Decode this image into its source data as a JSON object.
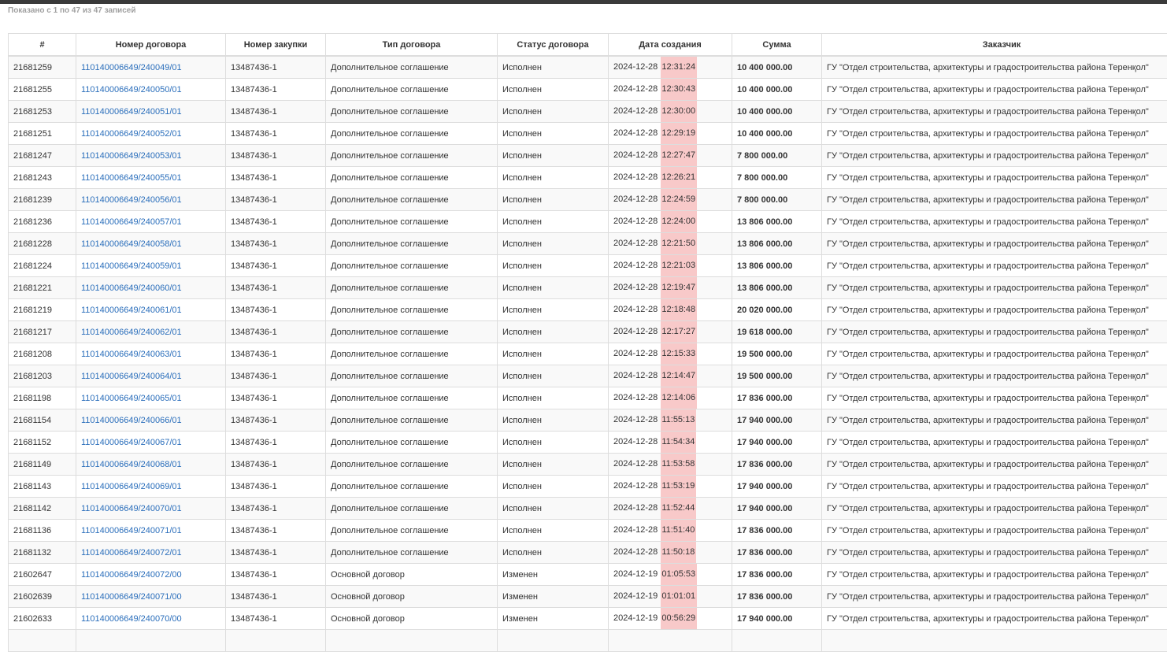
{
  "info": "Показано с 1 по 47 из 47 записей",
  "columns": [
    "#",
    "Номер договора",
    "Номер закупки",
    "Тип договора",
    "Статус договора",
    "Дата создания",
    "Сумма",
    "Заказчик"
  ],
  "rows": [
    {
      "id": "21681259",
      "contract": "110140006649/240049/01",
      "purchase": "13487436-1",
      "type": "Дополнительное соглашение",
      "status": "Исполнен",
      "date": "2024-12-28",
      "time": "12:31:24",
      "sum": "10 400 000.00",
      "customer": "ГУ \"Отдел строительства, архитектуры и градостроительства района Теренқол\""
    },
    {
      "id": "21681255",
      "contract": "110140006649/240050/01",
      "purchase": "13487436-1",
      "type": "Дополнительное соглашение",
      "status": "Исполнен",
      "date": "2024-12-28",
      "time": "12:30:43",
      "sum": "10 400 000.00",
      "customer": "ГУ \"Отдел строительства, архитектуры и градостроительства района Теренқол\""
    },
    {
      "id": "21681253",
      "contract": "110140006649/240051/01",
      "purchase": "13487436-1",
      "type": "Дополнительное соглашение",
      "status": "Исполнен",
      "date": "2024-12-28",
      "time": "12:30:00",
      "sum": "10 400 000.00",
      "customer": "ГУ \"Отдел строительства, архитектуры и градостроительства района Теренқол\""
    },
    {
      "id": "21681251",
      "contract": "110140006649/240052/01",
      "purchase": "13487436-1",
      "type": "Дополнительное соглашение",
      "status": "Исполнен",
      "date": "2024-12-28",
      "time": "12:29:19",
      "sum": "10 400 000.00",
      "customer": "ГУ \"Отдел строительства, архитектуры и градостроительства района Теренқол\""
    },
    {
      "id": "21681247",
      "contract": "110140006649/240053/01",
      "purchase": "13487436-1",
      "type": "Дополнительное соглашение",
      "status": "Исполнен",
      "date": "2024-12-28",
      "time": "12:27:47",
      "sum": "7 800 000.00",
      "customer": "ГУ \"Отдел строительства, архитектуры и градостроительства района Теренқол\""
    },
    {
      "id": "21681243",
      "contract": "110140006649/240055/01",
      "purchase": "13487436-1",
      "type": "Дополнительное соглашение",
      "status": "Исполнен",
      "date": "2024-12-28",
      "time": "12:26:21",
      "sum": "7 800 000.00",
      "customer": "ГУ \"Отдел строительства, архитектуры и градостроительства района Теренқол\""
    },
    {
      "id": "21681239",
      "contract": "110140006649/240056/01",
      "purchase": "13487436-1",
      "type": "Дополнительное соглашение",
      "status": "Исполнен",
      "date": "2024-12-28",
      "time": "12:24:59",
      "sum": "7 800 000.00",
      "customer": "ГУ \"Отдел строительства, архитектуры и градостроительства района Теренқол\""
    },
    {
      "id": "21681236",
      "contract": "110140006649/240057/01",
      "purchase": "13487436-1",
      "type": "Дополнительное соглашение",
      "status": "Исполнен",
      "date": "2024-12-28",
      "time": "12:24:00",
      "sum": "13 806 000.00",
      "customer": "ГУ \"Отдел строительства, архитектуры и градостроительства района Теренқол\""
    },
    {
      "id": "21681228",
      "contract": "110140006649/240058/01",
      "purchase": "13487436-1",
      "type": "Дополнительное соглашение",
      "status": "Исполнен",
      "date": "2024-12-28",
      "time": "12:21:50",
      "sum": "13 806 000.00",
      "customer": "ГУ \"Отдел строительства, архитектуры и градостроительства района Теренқол\""
    },
    {
      "id": "21681224",
      "contract": "110140006649/240059/01",
      "purchase": "13487436-1",
      "type": "Дополнительное соглашение",
      "status": "Исполнен",
      "date": "2024-12-28",
      "time": "12:21:03",
      "sum": "13 806 000.00",
      "customer": "ГУ \"Отдел строительства, архитектуры и градостроительства района Теренқол\""
    },
    {
      "id": "21681221",
      "contract": "110140006649/240060/01",
      "purchase": "13487436-1",
      "type": "Дополнительное соглашение",
      "status": "Исполнен",
      "date": "2024-12-28",
      "time": "12:19:47",
      "sum": "13 806 000.00",
      "customer": "ГУ \"Отдел строительства, архитектуры и градостроительства района Теренқол\""
    },
    {
      "id": "21681219",
      "contract": "110140006649/240061/01",
      "purchase": "13487436-1",
      "type": "Дополнительное соглашение",
      "status": "Исполнен",
      "date": "2024-12-28",
      "time": "12:18:48",
      "sum": "20 020 000.00",
      "customer": "ГУ \"Отдел строительства, архитектуры и градостроительства района Теренқол\""
    },
    {
      "id": "21681217",
      "contract": "110140006649/240062/01",
      "purchase": "13487436-1",
      "type": "Дополнительное соглашение",
      "status": "Исполнен",
      "date": "2024-12-28",
      "time": "12:17:27",
      "sum": "19 618 000.00",
      "customer": "ГУ \"Отдел строительства, архитектуры и градостроительства района Теренқол\""
    },
    {
      "id": "21681208",
      "contract": "110140006649/240063/01",
      "purchase": "13487436-1",
      "type": "Дополнительное соглашение",
      "status": "Исполнен",
      "date": "2024-12-28",
      "time": "12:15:33",
      "sum": "19 500 000.00",
      "customer": "ГУ \"Отдел строительства, архитектуры и градостроительства района Теренқол\""
    },
    {
      "id": "21681203",
      "contract": "110140006649/240064/01",
      "purchase": "13487436-1",
      "type": "Дополнительное соглашение",
      "status": "Исполнен",
      "date": "2024-12-28",
      "time": "12:14:47",
      "sum": "19 500 000.00",
      "customer": "ГУ \"Отдел строительства, архитектуры и градостроительства района Теренқол\""
    },
    {
      "id": "21681198",
      "contract": "110140006649/240065/01",
      "purchase": "13487436-1",
      "type": "Дополнительное соглашение",
      "status": "Исполнен",
      "date": "2024-12-28",
      "time": "12:14:06",
      "sum": "17 836 000.00",
      "customer": "ГУ \"Отдел строительства, архитектуры и градостроительства района Теренқол\""
    },
    {
      "id": "21681154",
      "contract": "110140006649/240066/01",
      "purchase": "13487436-1",
      "type": "Дополнительное соглашение",
      "status": "Исполнен",
      "date": "2024-12-28",
      "time": "11:55:13",
      "sum": "17 940 000.00",
      "customer": "ГУ \"Отдел строительства, архитектуры и градостроительства района Теренқол\""
    },
    {
      "id": "21681152",
      "contract": "110140006649/240067/01",
      "purchase": "13487436-1",
      "type": "Дополнительное соглашение",
      "status": "Исполнен",
      "date": "2024-12-28",
      "time": "11:54:34",
      "sum": "17 940 000.00",
      "customer": "ГУ \"Отдел строительства, архитектуры и градостроительства района Теренқол\""
    },
    {
      "id": "21681149",
      "contract": "110140006649/240068/01",
      "purchase": "13487436-1",
      "type": "Дополнительное соглашение",
      "status": "Исполнен",
      "date": "2024-12-28",
      "time": "11:53:58",
      "sum": "17 836 000.00",
      "customer": "ГУ \"Отдел строительства, архитектуры и градостроительства района Теренқол\""
    },
    {
      "id": "21681143",
      "contract": "110140006649/240069/01",
      "purchase": "13487436-1",
      "type": "Дополнительное соглашение",
      "status": "Исполнен",
      "date": "2024-12-28",
      "time": "11:53:19",
      "sum": "17 940 000.00",
      "customer": "ГУ \"Отдел строительства, архитектуры и градостроительства района Теренқол\""
    },
    {
      "id": "21681142",
      "contract": "110140006649/240070/01",
      "purchase": "13487436-1",
      "type": "Дополнительное соглашение",
      "status": "Исполнен",
      "date": "2024-12-28",
      "time": "11:52:44",
      "sum": "17 940 000.00",
      "customer": "ГУ \"Отдел строительства, архитектуры и градостроительства района Теренқол\""
    },
    {
      "id": "21681136",
      "contract": "110140006649/240071/01",
      "purchase": "13487436-1",
      "type": "Дополнительное соглашение",
      "status": "Исполнен",
      "date": "2024-12-28",
      "time": "11:51:40",
      "sum": "17 836 000.00",
      "customer": "ГУ \"Отдел строительства, архитектуры и градостроительства района Теренқол\""
    },
    {
      "id": "21681132",
      "contract": "110140006649/240072/01",
      "purchase": "13487436-1",
      "type": "Дополнительное соглашение",
      "status": "Исполнен",
      "date": "2024-12-28",
      "time": "11:50:18",
      "sum": "17 836 000.00",
      "customer": "ГУ \"Отдел строительства, архитектуры и градостроительства района Теренқол\""
    },
    {
      "id": "21602647",
      "contract": "110140006649/240072/00",
      "purchase": "13487436-1",
      "type": "Основной договор",
      "status": "Изменен",
      "date": "2024-12-19",
      "time": "01:05:53",
      "sum": "17 836 000.00",
      "customer": "ГУ \"Отдел строительства, архитектуры и градостроительства района Теренқол\""
    },
    {
      "id": "21602639",
      "contract": "110140006649/240071/00",
      "purchase": "13487436-1",
      "type": "Основной договор",
      "status": "Изменен",
      "date": "2024-12-19",
      "time": "01:01:01",
      "sum": "17 836 000.00",
      "customer": "ГУ \"Отдел строительства, архитектуры и градостроительства района Теренқол\""
    },
    {
      "id": "21602633",
      "contract": "110140006649/240070/00",
      "purchase": "13487436-1",
      "type": "Основной договор",
      "status": "Изменен",
      "date": "2024-12-19",
      "time": "00:56:29",
      "sum": "17 940 000.00",
      "customer": "ГУ \"Отдел строительства, архитектуры и градостроительства района Теренқол\""
    },
    {
      "id": "",
      "contract": "",
      "purchase": "",
      "type": "",
      "status": "",
      "date": "",
      "time": "",
      "sum": "",
      "customer": ""
    }
  ],
  "colors": {
    "link": "#2a6ebb",
    "time_highlight": "#f8c9c9",
    "row_stripe": "#f9f9f9",
    "border": "#dddddd"
  }
}
